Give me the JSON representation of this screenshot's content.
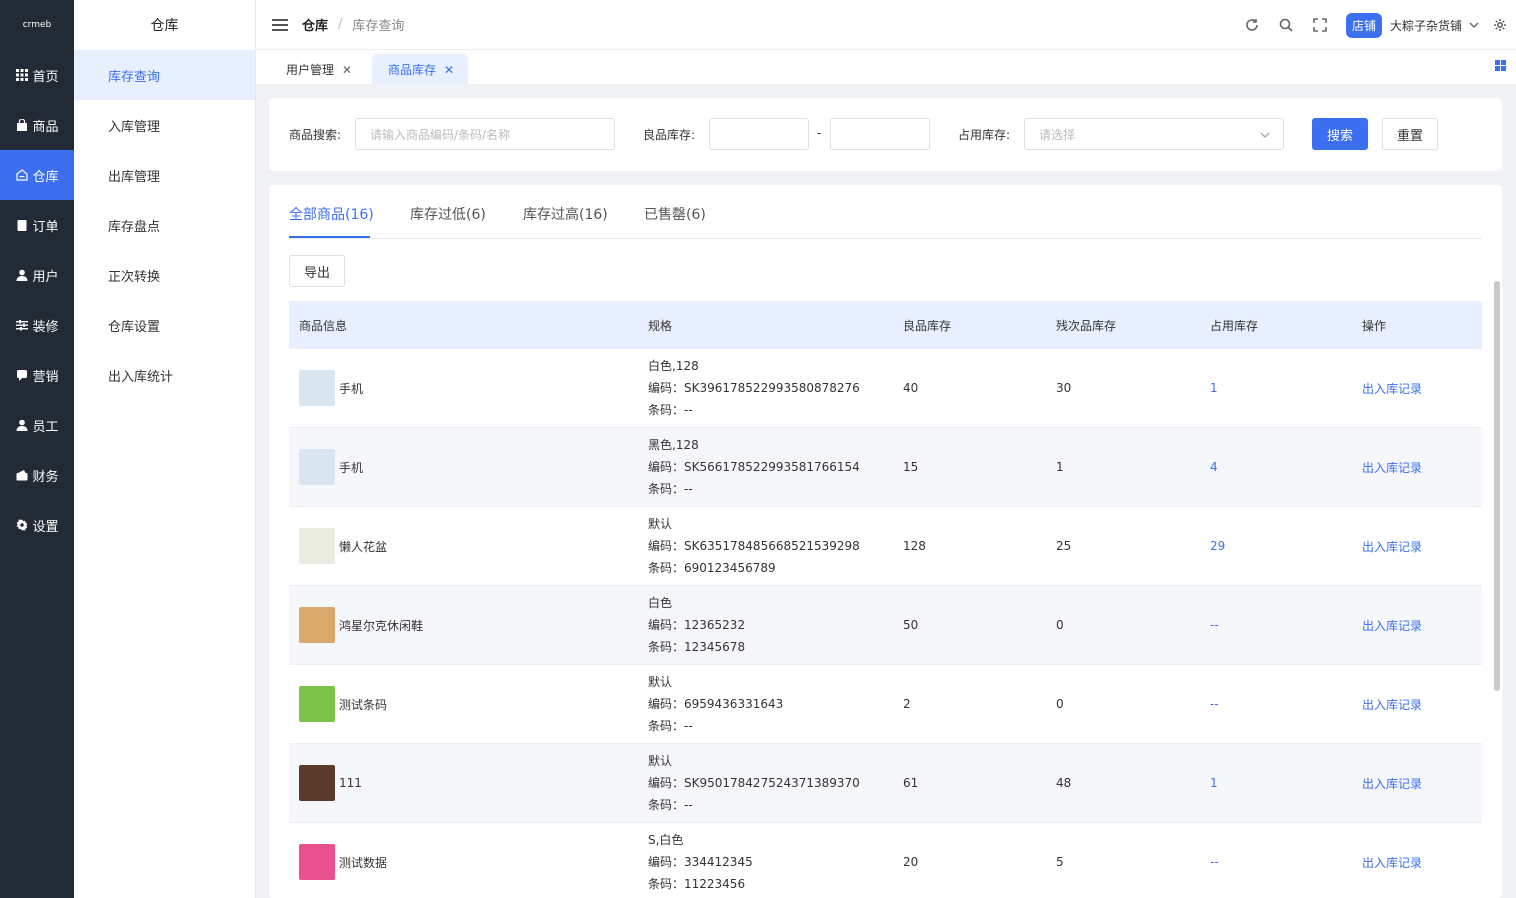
{
  "rail": {
    "logo": "crmeb",
    "items": [
      {
        "label": "首页",
        "icon": "grid-icon"
      },
      {
        "label": "商品",
        "icon": "bag-icon"
      },
      {
        "label": "仓库",
        "icon": "warehouse-icon"
      },
      {
        "label": "订单",
        "icon": "clipboard-icon"
      },
      {
        "label": "用户",
        "icon": "user-icon"
      },
      {
        "label": "装修",
        "icon": "sliders-icon"
      },
      {
        "label": "营销",
        "icon": "chat-icon"
      },
      {
        "label": "员工",
        "icon": "person-icon"
      },
      {
        "label": "财务",
        "icon": "wallet-icon"
      },
      {
        "label": "设置",
        "icon": "gear-icon"
      }
    ],
    "active_index": 2
  },
  "submenu": {
    "title": "仓库",
    "items": [
      "库存查询",
      "入库管理",
      "出库管理",
      "库存盘点",
      "正次转换",
      "仓库设置",
      "出入库统计"
    ],
    "active_index": 0
  },
  "header": {
    "breadcrumb": [
      "仓库",
      "库存查询"
    ],
    "separator": "/",
    "shop_badge": "店铺",
    "shop_name": "大粽子杂货铺"
  },
  "view_tabs": [
    {
      "label": "用户管理",
      "close": "✕"
    },
    {
      "label": "商品库存",
      "close": "✕"
    }
  ],
  "search": {
    "product_label": "商品搜索:",
    "product_placeholder": "请输入商品编码/条码/名称",
    "good_stock_label": "良品库存:",
    "range_dash": "-",
    "occupied_label": "占用库存:",
    "occupied_placeholder": "请选择",
    "search_button": "搜索",
    "reset_button": "重置"
  },
  "content_tabs": [
    "全部商品(16)",
    "库存过低(6)",
    "库存过高(16)",
    "已售罄(6)"
  ],
  "export_button": "导出",
  "table": {
    "headers": [
      "商品信息",
      "规格",
      "良品库存",
      "残次品库存",
      "占用库存",
      "操作"
    ],
    "rows": [
      {
        "name": "手机",
        "spec": "白色,128",
        "code": "编码：SK396178522993580878276",
        "barcode": "条码：--",
        "good": "40",
        "defective": "30",
        "occupied": "1",
        "action": "出入库记录",
        "thumb_color": "#d9e6f2"
      },
      {
        "name": "手机",
        "spec": "黑色,128",
        "code": "编码：SK566178522993581766154",
        "barcode": "条码：--",
        "good": "15",
        "defective": "1",
        "occupied": "4",
        "action": "出入库记录",
        "thumb_color": "#d9e6f2"
      },
      {
        "name": "懒人花盆",
        "spec": "默认",
        "code": "编码：SK635178485668521539298",
        "barcode": "条码：690123456789",
        "good": "128",
        "defective": "25",
        "occupied": "29",
        "action": "出入库记录",
        "thumb_color": "#e9ecdf"
      },
      {
        "name": "鸿星尔克休闲鞋",
        "spec": "白色",
        "code": "编码：12365232",
        "barcode": "条码：12345678",
        "good": "50",
        "defective": "0",
        "occupied": "--",
        "action": "出入库记录",
        "thumb_color": "#d9a86b"
      },
      {
        "name": "测试条码",
        "spec": "默认",
        "code": "编码：6959436331643",
        "barcode": "条码：--",
        "good": "2",
        "defective": "0",
        "occupied": "--",
        "action": "出入库记录",
        "thumb_color": "#7cc34a"
      },
      {
        "name": "111",
        "spec": "默认",
        "code": "编码：SK950178427524371389370",
        "barcode": "条码：--",
        "good": "61",
        "defective": "48",
        "occupied": "1",
        "action": "出入库记录",
        "thumb_color": "#5a3a2a"
      },
      {
        "name": "测试数据",
        "spec": "S,白色",
        "code": "编码：334412345",
        "barcode": "条码：11223456",
        "good": "20",
        "defective": "5",
        "occupied": "--",
        "action": "出入库记录",
        "thumb_color": "#e9508e"
      }
    ]
  }
}
